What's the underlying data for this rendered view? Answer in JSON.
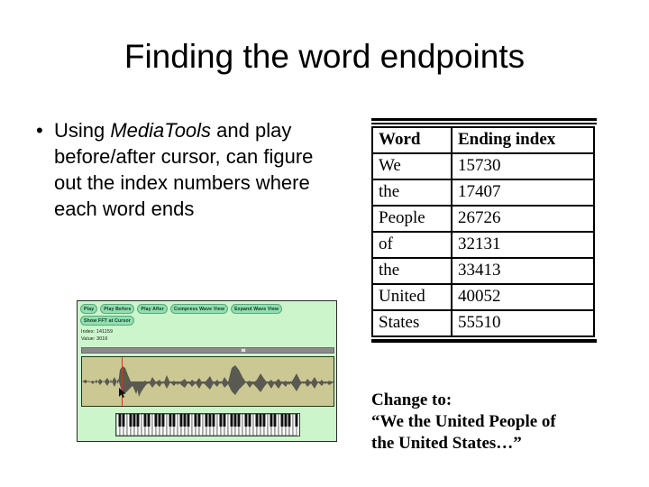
{
  "slide": {
    "title": "Finding the word endpoints"
  },
  "body": {
    "bullet_marker": "•",
    "bullet_text_part1": "Using ",
    "bullet_text_emphasis": "MediaTools",
    "bullet_text_part2": " and play before/after cursor, can figure out the index numbers where each word ends"
  },
  "mediatools": {
    "buttons_row1": [
      "Play",
      "Play Before",
      "Play After",
      "Compress Wave View",
      "Expand Wave View"
    ],
    "buttons_row2": [
      "Show FFT at Cursor"
    ],
    "index_readout": "Index: 141159",
    "value_readout": "Value: 3016",
    "colors": {
      "panel_background": "#ccf5cc",
      "button_background": "#8fdfb0",
      "wave_background": "#ccc894",
      "wave_color": "#5a5a52",
      "cursor_color": "#d83618",
      "scrollbar_track": "#8a8a8a",
      "scrollbar_thumb": "#e2e2e2"
    }
  },
  "table": {
    "headers": [
      "Word",
      "Ending index"
    ],
    "rows": [
      [
        "We",
        "15730"
      ],
      [
        "the",
        "17407"
      ],
      [
        "People",
        "26726"
      ],
      [
        "of",
        "32131"
      ],
      [
        "the",
        "33413"
      ],
      [
        "United",
        "40052"
      ],
      [
        "States",
        "55510"
      ]
    ]
  },
  "note": {
    "line1": "Change to:",
    "line2": "“We the United People of",
    "line3": "the United States…”"
  }
}
